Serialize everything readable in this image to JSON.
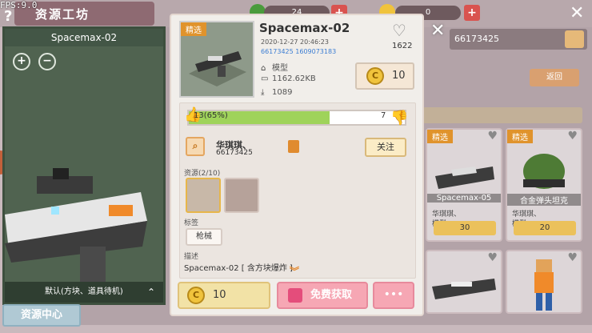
{
  "debug": {
    "fps": "FPS:9.0"
  },
  "app": {
    "title": "资源工坊",
    "help": "?",
    "close": "✕",
    "resources": [
      {
        "value": "24"
      },
      {
        "value": "0"
      }
    ]
  },
  "bg": {
    "search_value": "66173425",
    "return_label": "返回",
    "cards": [
      {
        "tag": "精选",
        "name": "Spacemax-05",
        "author": "华琪琪、",
        "type": "模型",
        "price": "30"
      },
      {
        "tag": "精选",
        "name": "合金弹头坦克",
        "author": "华琪琪、",
        "type": "模型",
        "price": "20"
      }
    ]
  },
  "preview": {
    "title": "Spacemax-02",
    "footer": "默认(方块、道具待机)",
    "footer_arrow": "⌃"
  },
  "left_tab": "资源中心",
  "modal": {
    "tag": "精选",
    "title": "Spacemax-02",
    "date": "2020-12-27   20:46:23",
    "ids": "66173425  1609073183",
    "type": "模型",
    "size": "1162.62KB",
    "downloads": "1089",
    "favorites": "1622",
    "price": "10",
    "votes": {
      "up_label": "13(65%)",
      "down": "7",
      "up_ratio": 0.65
    },
    "author": {
      "name": "华琪琪、",
      "id": "66173425",
      "follow": "关注"
    },
    "resources_label": "资源(2/10)",
    "tags_label": "标签",
    "tag_value": "枪械",
    "desc_label": "描述",
    "desc_text": "Spacemax-02 [ 含方块爆炸 ]",
    "buy_price": "10",
    "free_label": "免费获取",
    "more_label": "•••"
  },
  "colors": {
    "accent": "#e0932c",
    "vote_fill": "#9fd35a",
    "pink": "#f6a7b4"
  }
}
